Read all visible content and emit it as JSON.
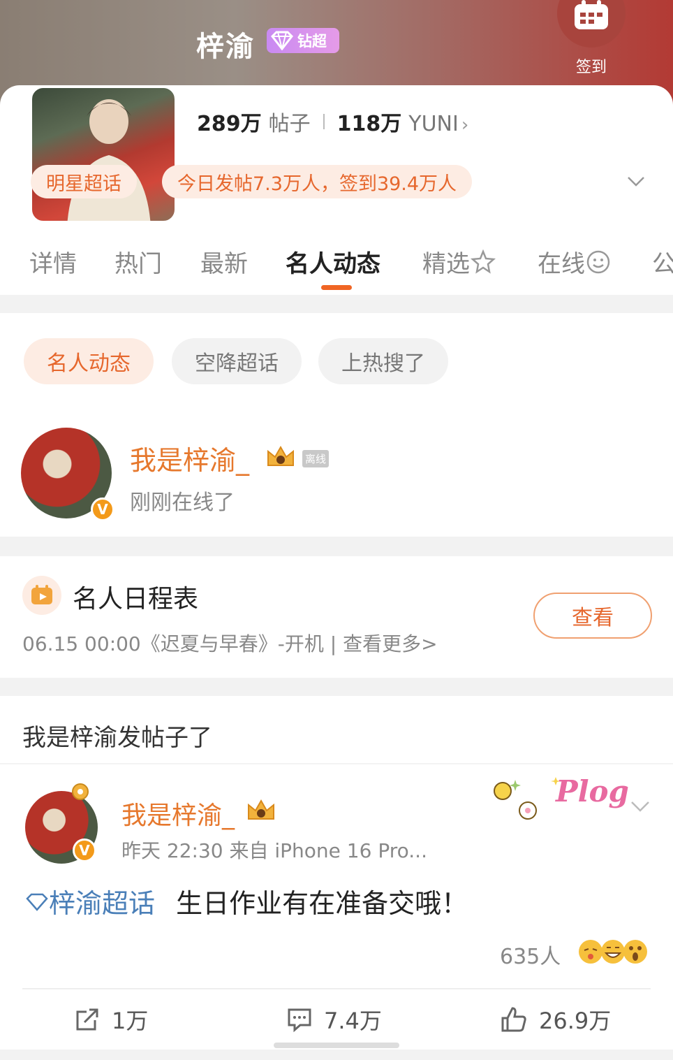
{
  "header": {
    "title": "梓渝",
    "tier_label": "钻超",
    "checkin_label": "签到"
  },
  "stats": {
    "posts_count": "289万",
    "posts_unit": "帖子",
    "fans_count": "118万",
    "fans_unit": "YUNI",
    "fans_chevron": "›"
  },
  "pills": {
    "category": "明星超话",
    "activity": "今日发帖7.3万人，签到39.4万人"
  },
  "tabs": [
    {
      "label": "详情"
    },
    {
      "label": "热门"
    },
    {
      "label": "最新"
    },
    {
      "label": "名人动态"
    },
    {
      "label": "精选"
    },
    {
      "label": "在线"
    },
    {
      "label": "公"
    }
  ],
  "filters": [
    {
      "label": "名人动态"
    },
    {
      "label": "空降超话"
    },
    {
      "label": "上热搜了"
    }
  ],
  "celebrity": {
    "name": "我是梓渝_",
    "status_tag": "离线",
    "status": "刚刚在线了",
    "verified_mark": "V"
  },
  "schedule": {
    "title": "名人日程表",
    "detail": "06.15 00:00《迟夏与早春》-开机 |  查看更多>",
    "view_button": "查看"
  },
  "feed_header": "我是梓渝发帖子了",
  "post": {
    "author": "我是梓渝_",
    "meta": "昨天 22:30  来自 iPhone 16 Pro...",
    "topic": "梓渝超话",
    "text": "生日作业有在准备交哦！",
    "sticker": "Plog",
    "reactions_count": "635人",
    "repost_count": "1万",
    "comment_count": "7.4万",
    "like_count": "26.9万"
  },
  "colors": {
    "accent": "#e6672d",
    "username": "#e6782d",
    "topic": "#4a7fb8",
    "tab_indicator": "#f06524"
  }
}
